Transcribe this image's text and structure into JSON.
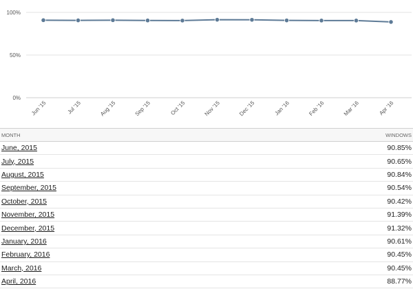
{
  "chart_data": {
    "type": "line",
    "categories": [
      "Jun '15",
      "Jul '15",
      "Aug '15",
      "Sep '15",
      "Oct '15",
      "Nov '15",
      "Dec '15",
      "Jan '16",
      "Feb '16",
      "Mar '16",
      "Apr '16"
    ],
    "series": [
      {
        "values": [
          90.85,
          90.65,
          90.84,
          90.54,
          90.42,
          91.39,
          91.32,
          90.61,
          90.45,
          90.45,
          88.77
        ]
      }
    ],
    "yticks": [
      "0%",
      "50%",
      "100%"
    ],
    "ylim": [
      0,
      100
    ],
    "grid": true,
    "line_color": "#5d7a96",
    "marker_color": "#5d7a96"
  },
  "table": {
    "headers": {
      "month": "MONTH",
      "value": "WINDOWS"
    },
    "rows": [
      {
        "month": "June, 2015",
        "value": "90.85%"
      },
      {
        "month": "July, 2015",
        "value": "90.65%"
      },
      {
        "month": "August, 2015",
        "value": "90.84%"
      },
      {
        "month": "September, 2015",
        "value": "90.54%"
      },
      {
        "month": "October, 2015",
        "value": "90.42%"
      },
      {
        "month": "November, 2015",
        "value": "91.39%"
      },
      {
        "month": "December, 2015",
        "value": "91.32%"
      },
      {
        "month": "January, 2016",
        "value": "90.61%"
      },
      {
        "month": "February, 2016",
        "value": "90.45%"
      },
      {
        "month": "March, 2016",
        "value": "90.45%"
      },
      {
        "month": "April, 2016",
        "value": "88.77%"
      }
    ]
  }
}
